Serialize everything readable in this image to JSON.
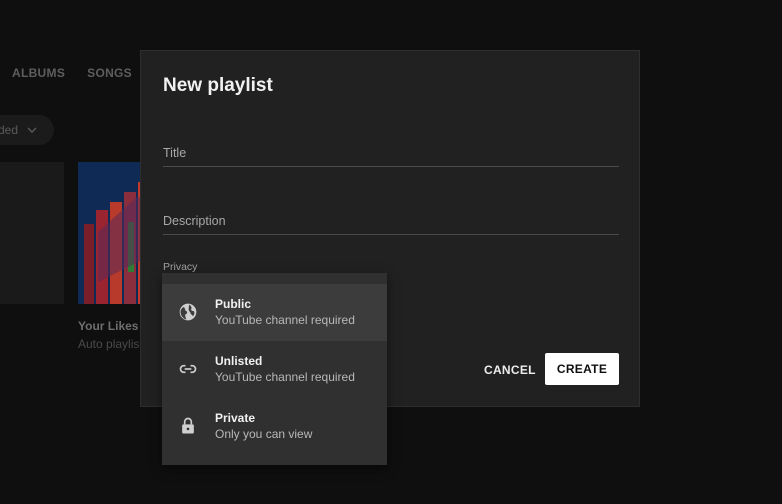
{
  "background": {
    "tabs": [
      "ALBUMS",
      "SONGS"
    ],
    "chip_label": "ded",
    "card": {
      "title": "Your Likes",
      "subtitle": "Auto playlis"
    }
  },
  "dialog": {
    "title": "New playlist",
    "title_field_label": "Title",
    "description_field_label": "Description",
    "privacy_label": "Privacy",
    "cancel_label": "CANCEL",
    "create_label": "CREATE"
  },
  "privacy_menu": {
    "selected": "Public",
    "options": [
      {
        "label": "Public",
        "sublabel": "YouTube channel required",
        "icon": "globe-icon"
      },
      {
        "label": "Unlisted",
        "sublabel": "YouTube channel required",
        "icon": "link-icon"
      },
      {
        "label": "Private",
        "sublabel": "Only you can view",
        "icon": "lock-icon"
      }
    ]
  },
  "colors": {
    "page_background": "#0f0f0f",
    "dialog_background": "#212121",
    "menu_background": "#303030",
    "menu_selected": "#3c3c3c",
    "create_button": "#ffffff"
  }
}
